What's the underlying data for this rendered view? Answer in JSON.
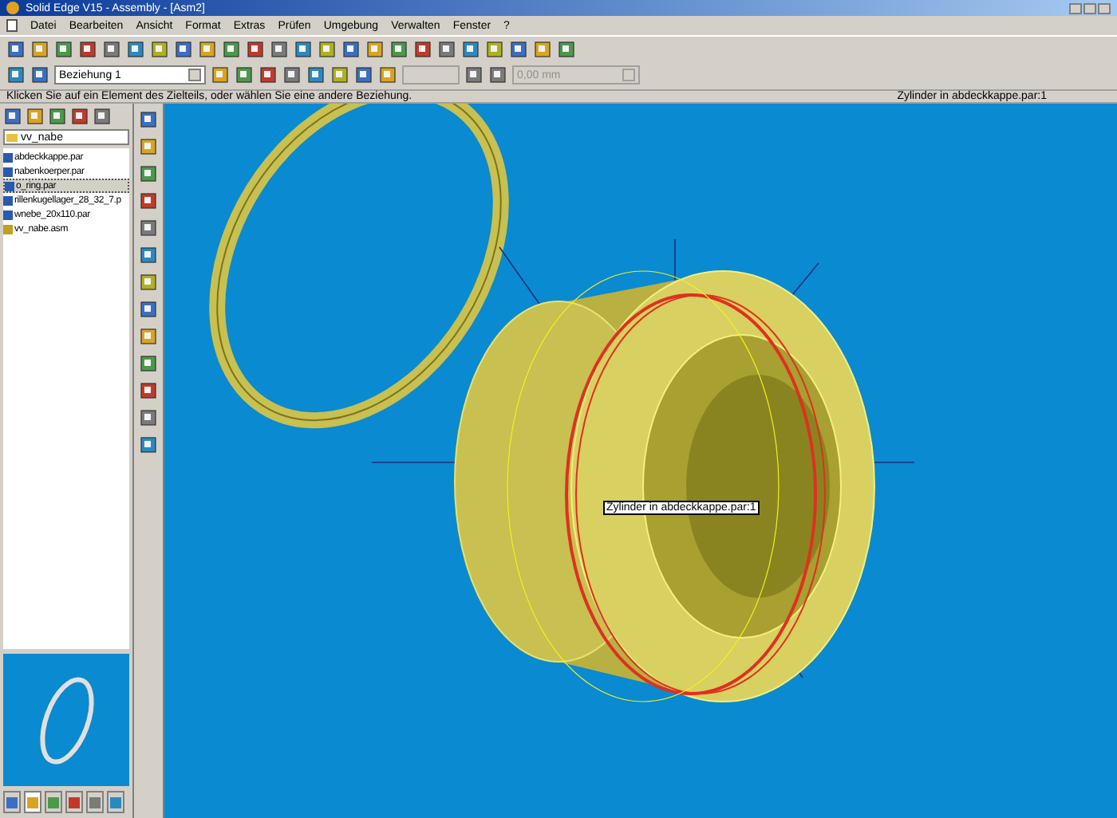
{
  "window": {
    "title": "Solid Edge V15 - Assembly - [Asm2]"
  },
  "menu": [
    "Datei",
    "Bearbeiten",
    "Ansicht",
    "Format",
    "Extras",
    "Prüfen",
    "Umgebung",
    "Verwalten",
    "Fenster",
    "?"
  ],
  "ribbon": {
    "relationship": "Beziehung 1",
    "offset": "0,00 mm"
  },
  "prompt": "Klicken Sie auf ein Element des Zielteils, oder wählen Sie eine andere Beziehung.",
  "status": "Zylinder in abdeckkappe.par:1",
  "library": {
    "folder": "vv_nabe",
    "files": [
      {
        "name": "abdeckkappe.par",
        "kind": "part",
        "selected": false
      },
      {
        "name": "nabenkoerper.par",
        "kind": "part",
        "selected": false
      },
      {
        "name": "o_ring.par",
        "kind": "part",
        "selected": true
      },
      {
        "name": "rillenkugellager_28_32_7.p",
        "kind": "part",
        "selected": false
      },
      {
        "name": "wnebe_20x110.par",
        "kind": "part",
        "selected": false
      },
      {
        "name": "vv_nabe.asm",
        "kind": "assembly",
        "selected": false
      }
    ]
  },
  "tooltip": "Zylinder in abdeckkappe.par:1",
  "panel_tabs": [
    {
      "selected": false
    },
    {
      "selected": true
    },
    {
      "selected": false
    },
    {
      "selected": false
    },
    {
      "selected": false
    },
    {
      "selected": false
    }
  ]
}
